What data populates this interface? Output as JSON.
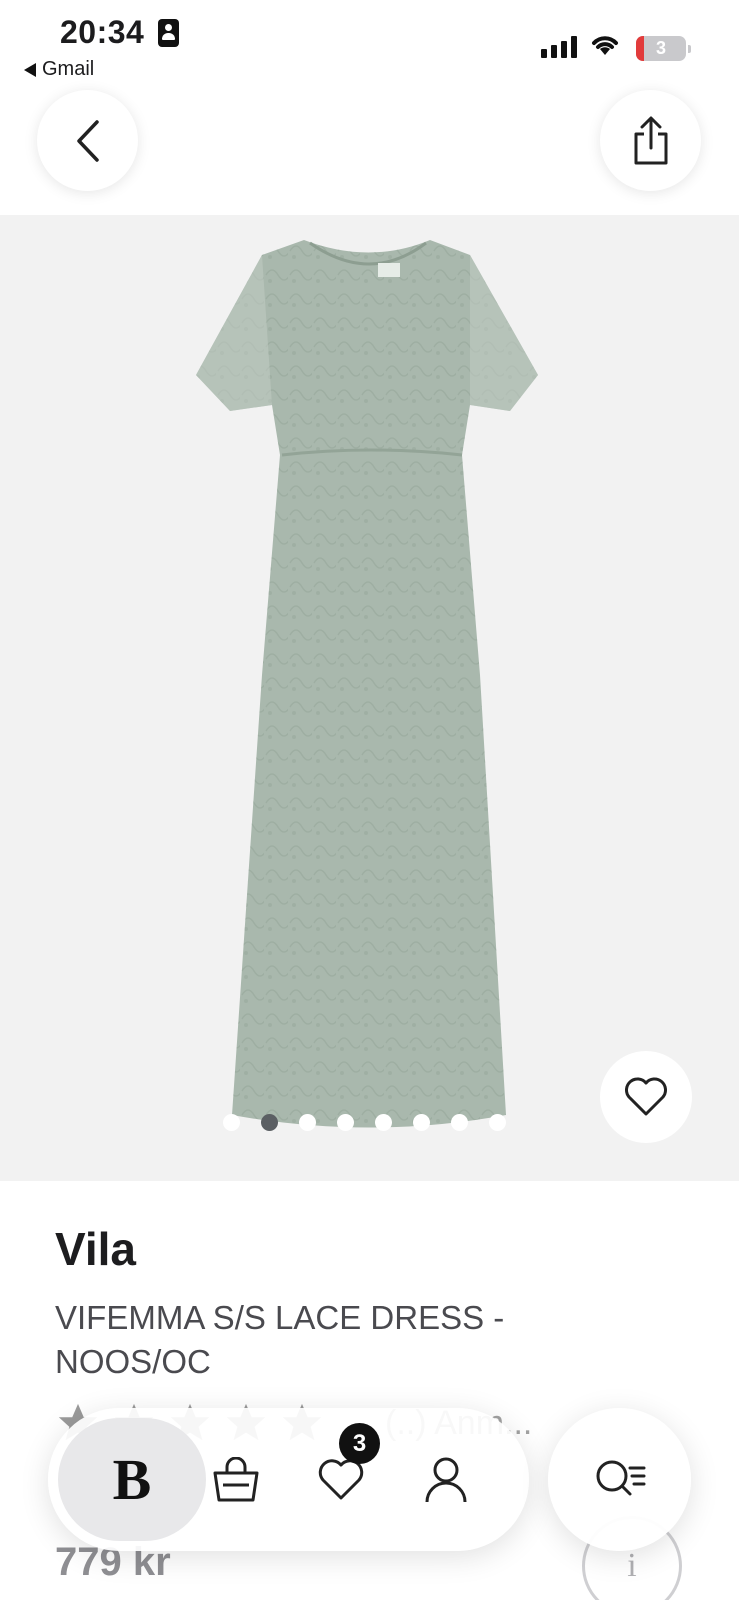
{
  "status_bar": {
    "time": "20:34",
    "back_app": "Gmail",
    "battery_level": "3"
  },
  "header": {
    "back_icon": "chevron-left-icon",
    "share_icon": "share-icon"
  },
  "gallery": {
    "image_count": 8,
    "active_index": 1,
    "favorite_icon": "heart-icon"
  },
  "product": {
    "brand": "Vila",
    "name": "VIFEMMA S/S LACE DRESS - NOOS/OC",
    "rating_count_text": "(..) Anm...",
    "price": "779 kr"
  },
  "bottom_nav": {
    "home_label": "B",
    "wishlist_count": "3",
    "icons": [
      "bag-icon",
      "heart-icon",
      "profile-icon",
      "search-icon"
    ]
  },
  "colors": {
    "dress": "#a9b8ad",
    "image_bg": "#f2f2f2",
    "active_dot": "#5b5f63"
  }
}
